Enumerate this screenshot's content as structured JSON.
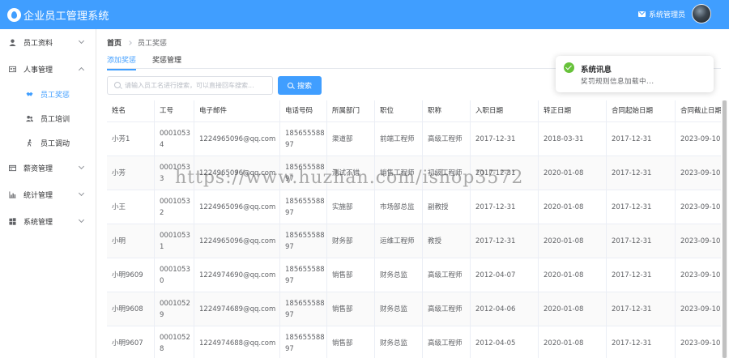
{
  "header": {
    "title": "企业员工管理系统",
    "user_label": "系统管理员"
  },
  "sidebar": {
    "menus": [
      {
        "label": "员工资料",
        "expanded": false
      },
      {
        "label": "人事管理",
        "expanded": true
      },
      {
        "label": "薪资管理",
        "expanded": false
      },
      {
        "label": "统计管理",
        "expanded": false
      },
      {
        "label": "系统管理",
        "expanded": false
      }
    ],
    "sub_items": [
      {
        "label": "员工奖惩",
        "active": true
      },
      {
        "label": "员工培训",
        "active": false
      },
      {
        "label": "员工调动",
        "active": false
      }
    ]
  },
  "breadcrumb": {
    "home": "首页",
    "current": "员工奖惩"
  },
  "tabs": [
    "添加奖惩",
    "奖惩管理"
  ],
  "search": {
    "placeholder": "请输入员工名进行搜索，可以直接回车搜索...",
    "button_label": "搜索"
  },
  "table": {
    "columns": [
      "姓名",
      "工号",
      "电子邮件",
      "电话号码",
      "所属部门",
      "职位",
      "职称",
      "入职日期",
      "转正日期",
      "合同起始日期",
      "合同截止日期"
    ],
    "rows": [
      [
        "小芳1",
        "0001053\n4",
        "1224965096@qq.com",
        "185655588\n97",
        "渠道部",
        "前端工程师",
        "高级工程师",
        "2017-12-31",
        "2018-03-31",
        "2017-12-31",
        "2023-09-10"
      ],
      [
        "小芳",
        "0001053\n3",
        "1224965096@qq.com",
        "185655588\n97",
        "测试不错",
        "销售工程师",
        "初级工程师",
        "2017-12-31",
        "2020-01-08",
        "2017-12-31",
        "2023-09-10"
      ],
      [
        "小王",
        "0001053\n2",
        "1224965096@qq.com",
        "185655588\n97",
        "实施部",
        "市场部总监",
        "副教授",
        "2017-12-31",
        "2020-01-08",
        "2017-12-31",
        "2023-09-10"
      ],
      [
        "小明",
        "0001053\n1",
        "1224965096@qq.com",
        "185655588\n97",
        "财务部",
        "运维工程师",
        "教授",
        "2017-12-31",
        "2020-01-08",
        "2017-12-31",
        "2023-09-10"
      ],
      [
        "小明9609",
        "0001053\n0",
        "1224974690@qq.com",
        "185655588\n97",
        "销售部",
        "财务总监",
        "高级工程师",
        "2012-04-07",
        "2020-01-08",
        "2017-12-31",
        "2023-09-10"
      ],
      [
        "小明9608",
        "0001052\n9",
        "1224974689@qq.com",
        "185655588\n97",
        "销售部",
        "财务总监",
        "高级工程师",
        "2012-04-06",
        "2020-01-08",
        "2017-12-31",
        "2023-09-10"
      ],
      [
        "小明9607",
        "0001052\n8",
        "1224974688@qq.com",
        "185655588\n97",
        "销售部",
        "财务总监",
        "高级工程师",
        "2012-04-05",
        "2020-01-08",
        "2017-12-31",
        "2023-09-10"
      ]
    ]
  },
  "toast": {
    "title": "系统讯息",
    "message": "奖罚规则信息加载中..."
  },
  "watermark": "https://www.huzhan.com/ishop3572",
  "colors": {
    "primary": "#409eff",
    "success": "#67c23a"
  }
}
